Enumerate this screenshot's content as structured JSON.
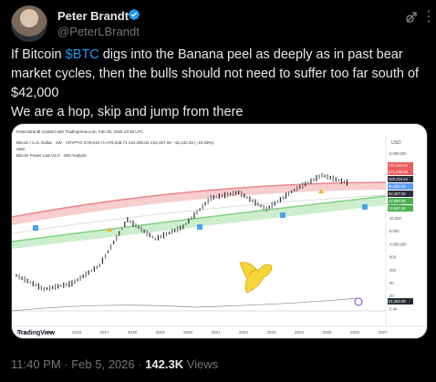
{
  "author": {
    "name": "Peter Brandt",
    "handle": "@PeterLBrandt",
    "verified_icon": "verified-badge-icon"
  },
  "tweet": {
    "line1_pre": "If Bitcoin ",
    "cashtag": "$BTC",
    "line1_post": " digs into the Banana peel as deeply as in past bear market cycles, then the bulls should not need to suffer too far south of $42,000",
    "line2": "We are a hop, skip and jump from there"
  },
  "meta": {
    "time_date": "11:40 PM · Feb 5, 2026 · ",
    "views_count": "142.3K",
    "views_label": " Views"
  },
  "chart_header": {
    "created_by": "PeterLBrandt created with TradingView.com, Feb 05, 2026 23:38 UTC",
    "symbol_line": "Bitcoin / U.S. Dollar · 1W · CRYPTO   O78,619.71  H79,348.71  L62,290.04  C62,407.06  −15,132.28 (−19.29%)",
    "sma_label": "SMA",
    "indicator_label": "Bitcoin Power Law V2.0 · 200 Analysis",
    "currency": "USD",
    "watermark": "TradingView"
  },
  "chart_data": {
    "type": "line",
    "x_ticks": [
      "2014",
      "2015",
      "2016",
      "2017",
      "2018",
      "2019",
      "2020",
      "2021",
      "2022",
      "2023",
      "2024",
      "2025",
      "2026",
      "2027"
    ],
    "y_ticks": [
      "8,000,000",
      "2,000,000",
      "800,000",
      "200,000",
      "80,000",
      "20,000",
      "8,000",
      "4,000,000",
      "800",
      "200",
      "80",
      "20",
      "0.40"
    ],
    "right_badges": [
      "747,484.00",
      "271,293.00",
      "329,224.42",
      "93,000.00",
      "62,407.00",
      "32,600.00",
      "19,941.56",
      "51,363.09"
    ],
    "log_scale": true,
    "series": [
      {
        "name": "Bitcoin / U.S. Dollar",
        "x": [
          2014,
          2015,
          2016,
          2017,
          2018,
          2019,
          2020,
          2021,
          2022,
          2023,
          2024,
          2025,
          2026
        ],
        "values": [
          600,
          300,
          400,
          1000,
          10000,
          3800,
          7000,
          30000,
          40000,
          17000,
          45000,
          95000,
          62407
        ]
      }
    ]
  },
  "colors": {
    "upper_band": "#e8878a",
    "lower_band": "#7fd17f",
    "accent": "#1d9bf0"
  }
}
